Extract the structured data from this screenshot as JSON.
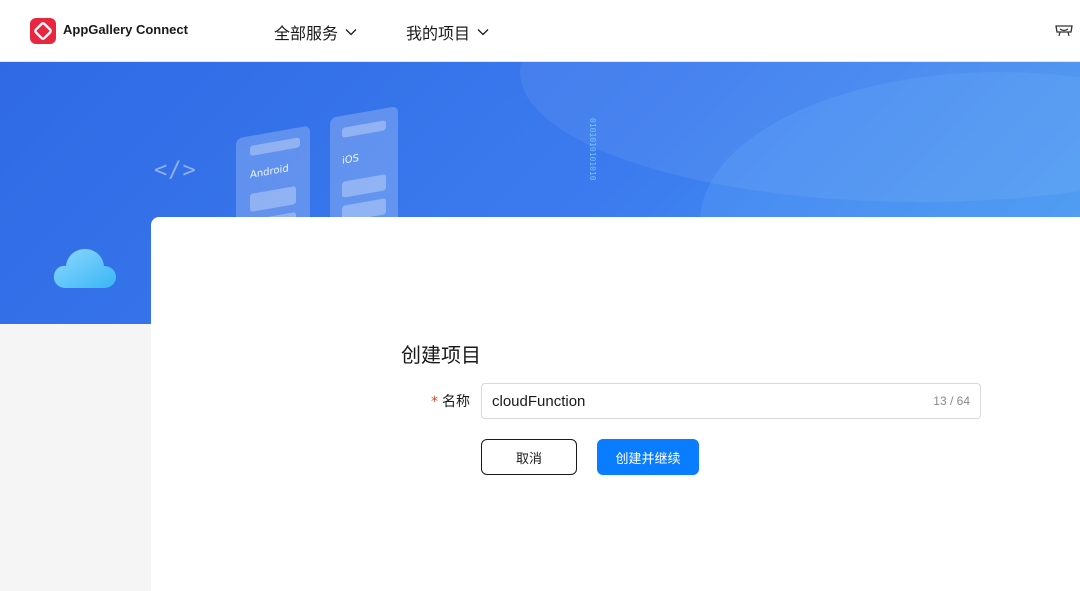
{
  "header": {
    "brand": "AppGallery Connect",
    "nav_all_services": "全部服务",
    "nav_my_projects": "我的项目"
  },
  "banner": {
    "code_symbol": "</>",
    "android_label": "Android",
    "ios_label": "iOS",
    "binary": "0101010101010"
  },
  "form": {
    "title": "创建项目",
    "required_mark": "*",
    "name_label": "名称",
    "name_value": "cloudFunction",
    "name_counter": "13 / 64",
    "cancel_label": "取消",
    "create_label": "创建并继续"
  },
  "colors": {
    "brand_red": "#e8263f",
    "primary_blue": "#0a7cff",
    "banner_blue": "#3b7bef"
  },
  "icons": {
    "logo": "appgallery-logo-icon",
    "dropdown": "chevron-down-icon",
    "support": "customer-service-icon",
    "cloud": "cloud-icon"
  }
}
